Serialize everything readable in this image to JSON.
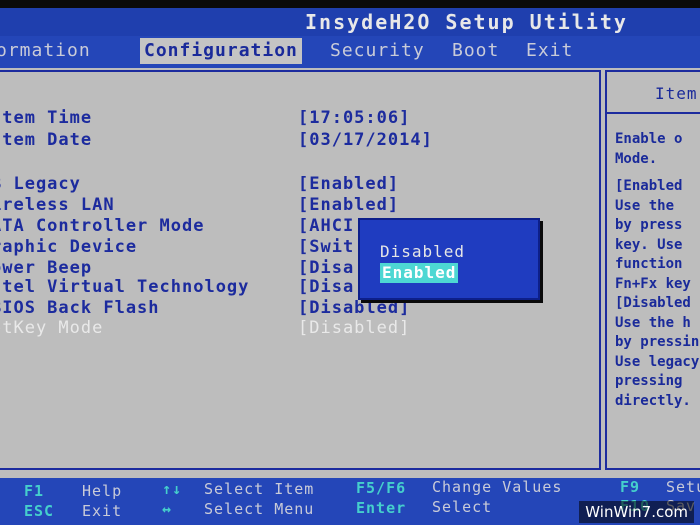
{
  "title": "InsydeH2O Setup Utility",
  "menu": [
    {
      "label": "ormation",
      "active": false
    },
    {
      "label": "Configuration",
      "active": true
    },
    {
      "label": "Security",
      "active": false
    },
    {
      "label": "Boot",
      "active": false
    },
    {
      "label": "Exit",
      "active": false
    }
  ],
  "settings": [
    {
      "label": "stem Time",
      "value": "[17:05:06]"
    },
    {
      "label": "stem Date",
      "value": "[03/17/2014]"
    },
    {
      "label": "B Legacy",
      "value": "[Enabled]"
    },
    {
      "label": "ireless LAN",
      "value": "[Enabled]"
    },
    {
      "label": "ATA Controller Mode",
      "value": "[AHCI"
    },
    {
      "label": "raphic Device",
      "value": "[Swit"
    },
    {
      "label": "ower Beep",
      "value": "[Disa"
    },
    {
      "label": "ntel Virtual Technology",
      "value": "[Disa"
    },
    {
      "label": "BIOS Back Flash",
      "value": "[Disabled]"
    },
    {
      "label": "otKey Mode",
      "value": "[Disabled]"
    }
  ],
  "popup": {
    "options": [
      "Disabled",
      "Enabled"
    ],
    "selected": "Enabled"
  },
  "help": {
    "title": "Item",
    "lines": [
      "Enable o",
      "Mode.",
      "",
      "[Enabled",
      "Use the",
      "by press",
      "key. Use",
      "function",
      "Fn+Fx key",
      "[Disabled",
      "Use the h",
      "by pressin",
      "Use legacy",
      "pressing",
      "directly."
    ]
  },
  "footer": [
    {
      "key": "F1",
      "action": "Help"
    },
    {
      "key": "ESC",
      "action": "Exit"
    },
    {
      "key": "↑↓",
      "action": "Select Item"
    },
    {
      "key": "↔",
      "action": "Select Menu"
    },
    {
      "key": "F5/F6",
      "action": "Change Values"
    },
    {
      "key": "Enter",
      "action": "Select"
    },
    {
      "key": "F9",
      "action": "Setup"
    },
    {
      "key": "F10",
      "action": "Sav"
    }
  ],
  "watermark": "WinWin7.com",
  "colors": {
    "header_blue": "#2446b8",
    "panel_gray": "#bdbdbd",
    "text_blue": "#1c2b9e",
    "highlight_cyan": "#4dd7d3"
  }
}
